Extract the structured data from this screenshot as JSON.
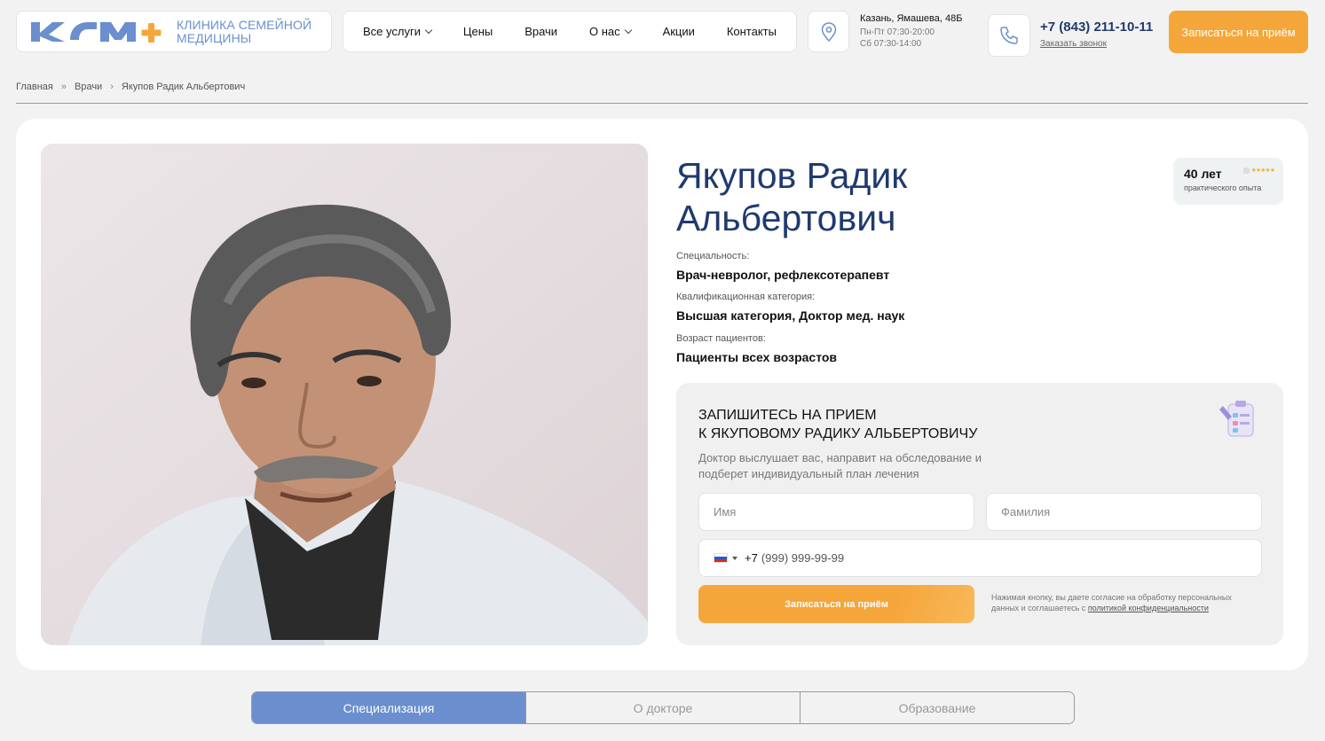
{
  "header": {
    "logo_text_line1": "Клиника семейной",
    "logo_text_line2": "медицины",
    "nav": [
      {
        "label": "Все услуги",
        "dropdown": true
      },
      {
        "label": "Цены",
        "dropdown": false
      },
      {
        "label": "Врачи",
        "dropdown": false
      },
      {
        "label": "О нас",
        "dropdown": true
      },
      {
        "label": "Акции",
        "dropdown": false
      },
      {
        "label": "Контакты",
        "dropdown": false
      }
    ],
    "address": "Казань, Ямашева, 48Б",
    "hours_weekdays": "Пн-Пт 07:30-20:00",
    "hours_saturday": "Сб 07:30-14:00",
    "phone": "+7 (843) 211-10-11",
    "callback": "Заказать звонок",
    "cta": "Записаться на приём"
  },
  "breadcrumb": {
    "home": "Главная",
    "doctors": "Врачи",
    "current": "Якупов Радик Альбертович"
  },
  "doctor": {
    "name_line1": "Якупов Радик",
    "name_line2": "Альбертович",
    "experience_years": "40 лет",
    "experience_label": "практического опыта",
    "specialty_label": "Специальность:",
    "specialty": "Врач-невролог, рефлексотерапевт",
    "category_label": "Квалификационная категория:",
    "category": "Высшая категория, Доктор мед. наук",
    "age_label": "Возраст пациентов:",
    "age": "Пациенты всех возрастов"
  },
  "form": {
    "title_line1": "Запишитесь на прием",
    "title_line2": "к Якуповому Радику Альбертовичу",
    "subtitle": "Доктор выслушает вас, направит на обследование и подберет индивидуальный план лечения",
    "first_name_placeholder": "Имя",
    "last_name_placeholder": "Фамилия",
    "phone_code": "+7",
    "phone_placeholder": "(999) 999-99-99",
    "submit": "Записаться на приём",
    "consent_text": "Нажимая кнопку, вы даете согласие на обработку персональных данных и соглашаетесь с",
    "consent_link": "политикой конфиденциальности"
  },
  "tabs": [
    {
      "label": "Специализация",
      "active": true
    },
    {
      "label": "О докторе",
      "active": false
    },
    {
      "label": "Образование",
      "active": false
    }
  ],
  "colors": {
    "brand_blue": "#6b8fce",
    "heading_navy": "#1f3a6e",
    "accent_orange": "#f5a63a"
  }
}
